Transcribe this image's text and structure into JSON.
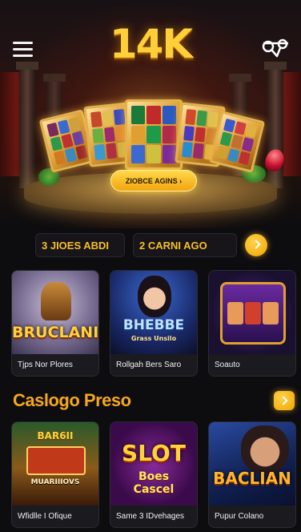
{
  "header": {
    "logo_text": "14K",
    "menu_icon": "hamburger-menu-icon",
    "gift_icon": "gift-icon"
  },
  "hero": {
    "promo_button": "ZIOBCE AGINS ›"
  },
  "tickers": {
    "items": [
      "3 JIOES ABDI",
      "2 CARNI AGO"
    ]
  },
  "top_games": [
    {
      "title": "BRUCLANI",
      "caption": "Tjps Nor Plores"
    },
    {
      "title": "BHEBBE",
      "subtitle": "Grass Unsilo",
      "caption": "Rollgah Bers Saro"
    },
    {
      "title": "",
      "caption": "Soauto"
    }
  ],
  "section": {
    "title": "Caslogo Preso"
  },
  "more_games": [
    {
      "title": "BAR6II",
      "subtitle": "MUARIIIOVS",
      "caption": "Wfidlle I Ofique"
    },
    {
      "title": "SLOT",
      "subtitle": "Boes Cascel",
      "caption": "Same 3 IDvehages"
    },
    {
      "title": "BACLIAN",
      "caption": "Pupur Colano"
    }
  ],
  "colors": {
    "accent_gold": "#f6c02a",
    "section_orange": "#f6a71e",
    "background": "#0d0c0f"
  }
}
